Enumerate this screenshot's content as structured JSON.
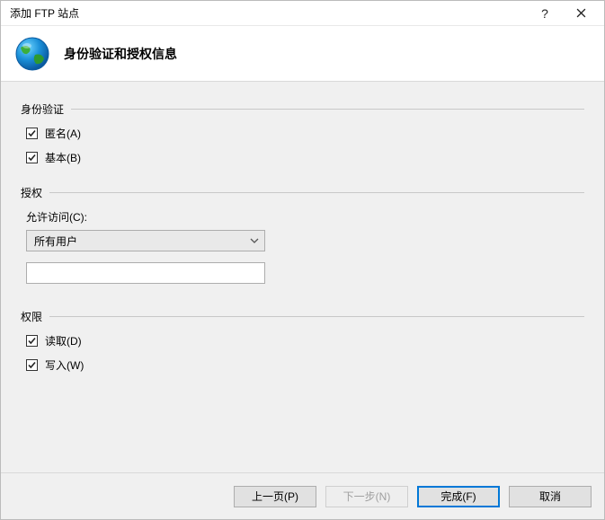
{
  "window": {
    "title": "添加 FTP 站点",
    "heading": "身份验证和授权信息"
  },
  "auth_group": {
    "label": "身份验证",
    "anonymous": "匿名(A)",
    "basic": "基本(B)"
  },
  "authz_group": {
    "label": "授权",
    "allow_access_label": "允许访问(C):",
    "allow_access_selected": "所有用户",
    "specific_value": ""
  },
  "perm_group": {
    "label": "权限",
    "read": "读取(D)",
    "write": "写入(W)"
  },
  "buttons": {
    "prev": "上一页(P)",
    "next": "下一步(N)",
    "finish": "完成(F)",
    "cancel": "取消"
  }
}
